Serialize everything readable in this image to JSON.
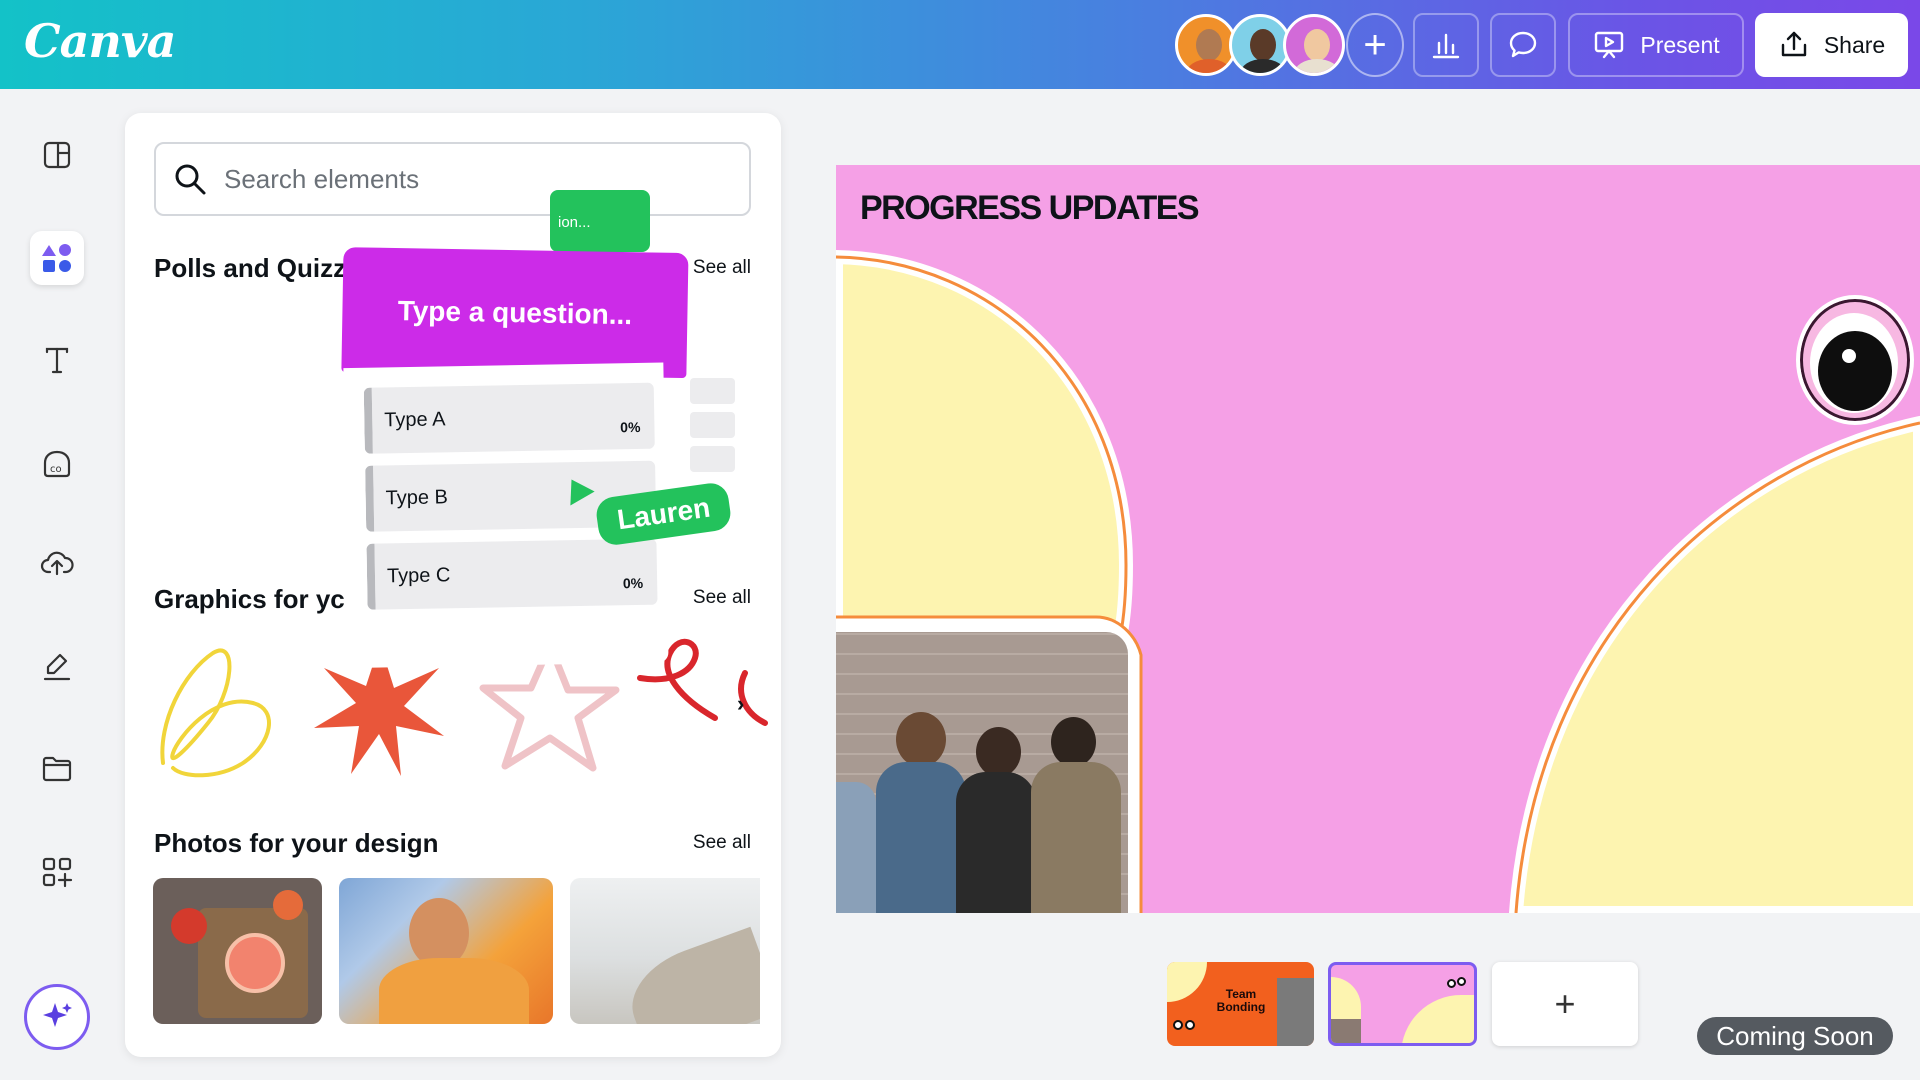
{
  "app": {
    "logo": "Canva"
  },
  "header": {
    "present_label": "Present",
    "share_label": "Share",
    "add_collaborator": "+"
  },
  "rail": {
    "items": [
      "design-icon",
      "elements-icon",
      "text-icon",
      "brand-icon",
      "uploads-icon",
      "draw-icon",
      "projects-icon",
      "apps-icon"
    ],
    "active": "elements-icon"
  },
  "panel": {
    "search_placeholder": "Search elements",
    "sections": [
      {
        "title": "Polls and Quizze",
        "see_all": "See all"
      },
      {
        "title": "Graphics for yc",
        "see_all": "See all"
      },
      {
        "title": "Photos for your design",
        "see_all": "See all"
      }
    ]
  },
  "poll": {
    "question": "Type a question...",
    "green_card_text": "ion...",
    "options": [
      {
        "label": "Type A",
        "pct": "0%"
      },
      {
        "label": "Type B",
        "pct": ""
      },
      {
        "label": "Type C",
        "pct": "0%"
      }
    ],
    "cursor_name": "Lauren"
  },
  "slide": {
    "title": "PROGRESS UPDATES"
  },
  "pages": {
    "thumb1_text": "Team Bonding",
    "add_page": "+"
  },
  "badge": {
    "coming_soon": "Coming Soon"
  },
  "colors": {
    "slide_bg": "#f5a0e6",
    "blob": "#fdf4b0",
    "blob_border": "#f58c3c",
    "poll_head": "#cc2be8",
    "green": "#23c25c",
    "accent": "#7d5cf0"
  }
}
